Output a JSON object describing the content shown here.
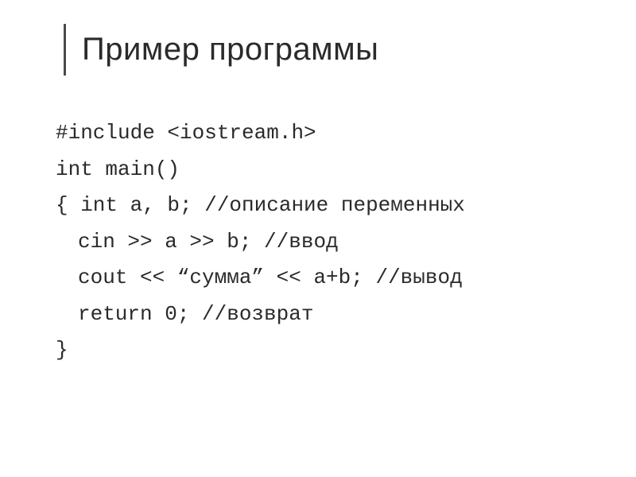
{
  "title": "Пример программы",
  "code": {
    "line1": "#include <iostream.h>",
    "line2": "int main()",
    "line3": "{ int a, b; //описание переменных",
    "line4": "cin >> a >> b; //ввод",
    "line5": "cout << “сумма” << a+b; //вывод",
    "line6": "return 0; //возврат",
    "line7": "}"
  }
}
